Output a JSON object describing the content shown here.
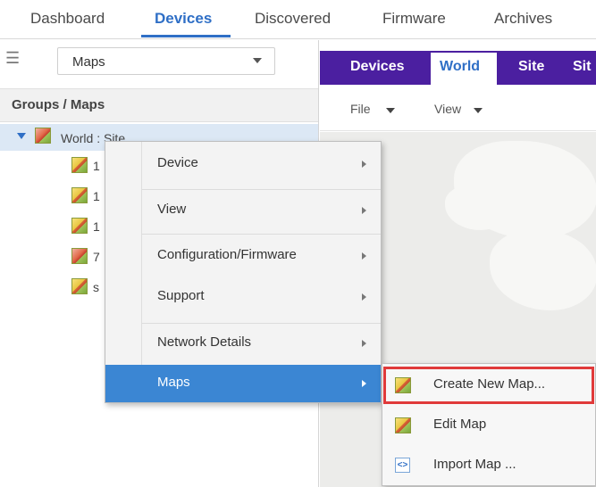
{
  "topnav": {
    "tabs": [
      "Dashboard",
      "Devices",
      "Discovered",
      "Firmware",
      "Archives"
    ],
    "active": "Devices"
  },
  "leftpanel": {
    "view_select": "Maps",
    "groups_header": "Groups / Maps",
    "tree_root": "World : Site",
    "children": [
      "1",
      "1",
      "1",
      "7",
      "s"
    ]
  },
  "rightpanel": {
    "tabs": [
      "Devices",
      "World",
      "Site",
      "Sit"
    ],
    "active_tab": "World",
    "file_menu": "File",
    "view_menu": "View"
  },
  "context_menu": {
    "items": [
      {
        "label": "Device",
        "has_submenu": true
      },
      {
        "label": "View",
        "has_submenu": true
      },
      {
        "label": "Configuration/Firmware",
        "has_submenu": true
      },
      {
        "label": "Support",
        "has_submenu": true
      },
      {
        "label": "Network Details",
        "has_submenu": true
      },
      {
        "label": "Maps",
        "has_submenu": true,
        "active": true
      }
    ]
  },
  "submenu": {
    "items": [
      {
        "label": "Create New Map...",
        "icon": "create-map-icon",
        "highlighted": true
      },
      {
        "label": "Edit Map",
        "icon": "edit-map-icon"
      },
      {
        "label": "Import Map ...",
        "icon": "import-map-icon"
      }
    ]
  },
  "colors": {
    "accent": "#2f6fc6",
    "purple_bar": "#4b1fa0",
    "menu_active": "#3b86d3",
    "highlight_border": "#e03a3a"
  }
}
